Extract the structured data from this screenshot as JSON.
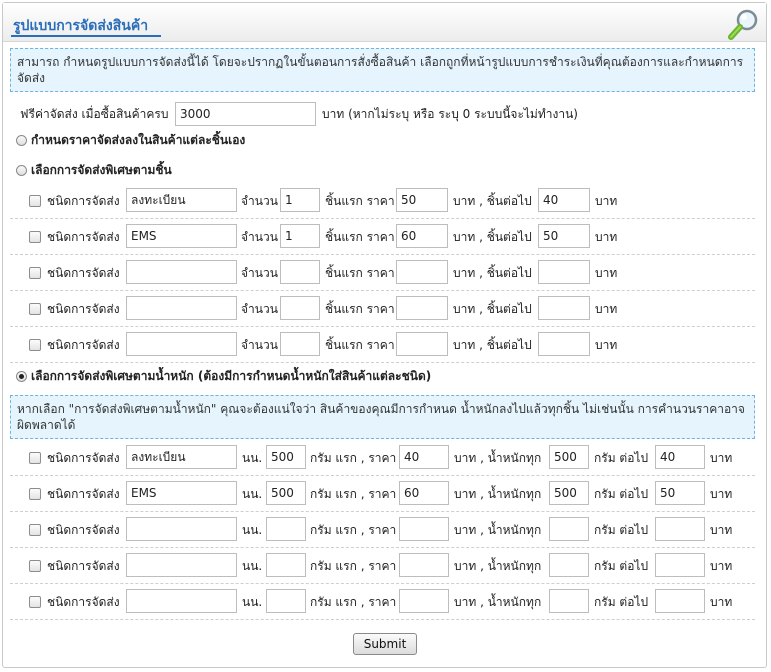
{
  "header": {
    "title": "รูปแบบการจัดส่งสินค้า"
  },
  "info1": "สามารถ กำหนดรูปแบบการจัดส่งนี้ได้ โดยจะปรากฏในขั้นตอนการสั่งซื้อสินค้า เลือกถูกที่หน้ารูปแบบการชำระเงินที่คุณต้องการและกำหนดการจัดส่ง",
  "free_shipping": {
    "label": "ฟรีค่าจัดส่ง เมื่อซื้อสินค้าครบ",
    "value": "3000",
    "suffix": "บาท (หากไม่ระบุ หรือ ระบุ 0 ระบบนี้จะไม่ทำงาน)"
  },
  "option1": {
    "label": "กำหนดราคาจัดส่งลงในสินค้าแต่ละชิ้นเอง",
    "checked": false
  },
  "option2": {
    "label": "เลือกการจัดส่งพิเศษตามชิ้น",
    "checked": false
  },
  "option3": {
    "label": "เลือกการจัดส่งพิเศษตามน้ำหนัก (ต้องมีการกำหนดน้ำหนักใส่สินค้าแต่ละชนิด)",
    "checked": true
  },
  "info2": "หากเลือก \"การจัดส่งพิเศษตามน้ำหนัก\" คุณจะต้องแน่ใจว่า สินค้าของคุณมีการกำหนด น้ำหนักลงไปแล้วทุกชิ้น ไม่เช่นนั้น การคำนวนราคาอาจผิดพลาดได้",
  "labels": {
    "ship_type": "ชนิดการจัดส่ง",
    "quantity": "จำนวน",
    "first_price": "ชิ้นแรก ราคา",
    "baht_next": "บาท , ชิ้นต่อไป",
    "baht": "บาท",
    "weight_unit": "นน.",
    "gram_first": "กรัม แรก , ราคา",
    "baht_weight_every": "บาท , น้ำหนักทุก",
    "gram_next": "กรัม ต่อไป"
  },
  "piece_rows": [
    {
      "type": "ลงทะเบียน",
      "qty": "1",
      "first": "50",
      "next": "40"
    },
    {
      "type": "EMS",
      "qty": "1",
      "first": "60",
      "next": "50"
    },
    {
      "type": "",
      "qty": "",
      "first": "",
      "next": ""
    },
    {
      "type": "",
      "qty": "",
      "first": "",
      "next": ""
    },
    {
      "type": "",
      "qty": "",
      "first": "",
      "next": ""
    }
  ],
  "weight_rows": [
    {
      "type": "ลงทะเบียน",
      "weight": "500",
      "price": "40",
      "every": "500",
      "next": "40"
    },
    {
      "type": "EMS",
      "weight": "500",
      "price": "60",
      "every": "500",
      "next": "50"
    },
    {
      "type": "",
      "weight": "",
      "price": "",
      "every": "",
      "next": ""
    },
    {
      "type": "",
      "weight": "",
      "price": "",
      "every": "",
      "next": ""
    },
    {
      "type": "",
      "weight": "",
      "price": "",
      "every": "",
      "next": ""
    }
  ],
  "submit_label": "Submit"
}
